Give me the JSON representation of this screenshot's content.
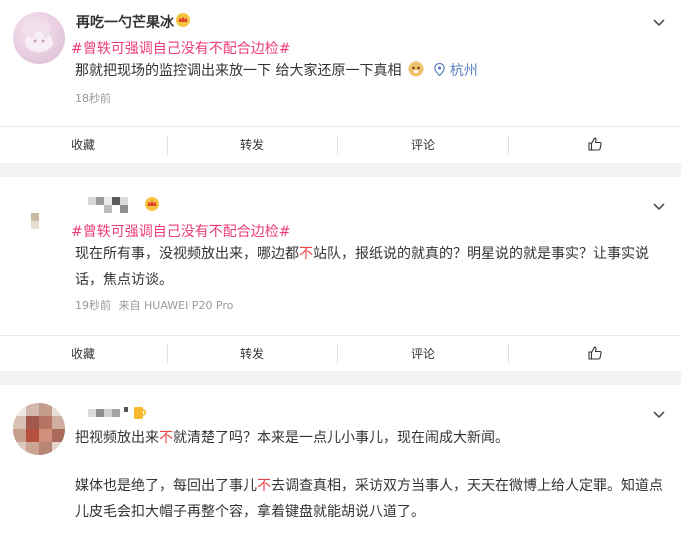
{
  "posts": [
    {
      "username": "再吃一勺芒果冰",
      "topic": "#曾轶可强调自己没有不配合边检#",
      "text": "那就把现场的监控调出来放一下 给大家还原一下真相",
      "emoji": "doge-emoji",
      "location": "杭州",
      "time": "18秒前",
      "actions": [
        "收藏",
        "转发",
        "评论"
      ]
    },
    {
      "topic": "#曾轶可强调自己没有不配合边检#",
      "text_line1_a": "现在所有事，没视频放出来，哪边都",
      "text_line1_hl": "不",
      "text_line1_b": "站队，报纸说的就真的？明星说的就是事实？让事实说",
      "text_line2": "话，焦点访谈。",
      "time": "19秒前",
      "source": "来自 HUAWEI P20 Pro",
      "actions": [
        "收藏",
        "转发",
        "评论"
      ]
    },
    {
      "line1_a": "把视频放出来",
      "line1_hl": "不",
      "line1_b": "就清楚了吗？本来是一点儿小事儿，现在闹成大新闻。",
      "line2_a": "媒体也是绝了，每回出了事儿",
      "line2_hl": "不",
      "line2_b": "去调查真相，采访双方当事人，天天在微博上给人定罪。知道点",
      "line3": "儿皮毛会扣大帽子再整个容，拿着键盘就能胡说八道了。"
    }
  ]
}
